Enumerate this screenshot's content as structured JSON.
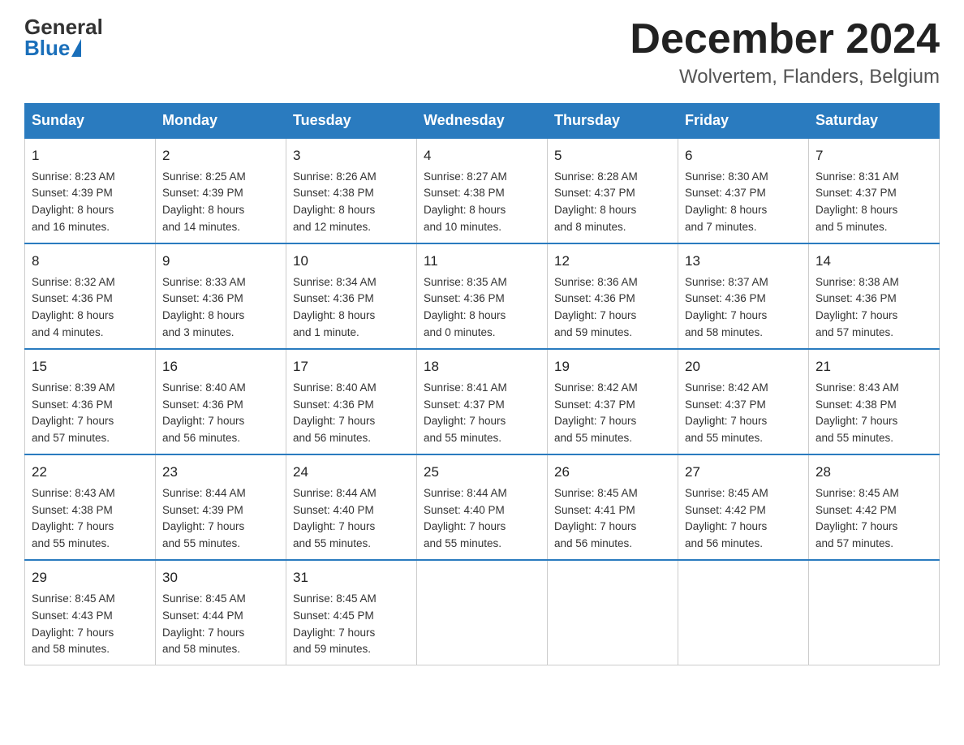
{
  "logo": {
    "general": "General",
    "blue": "Blue"
  },
  "title": {
    "month": "December 2024",
    "location": "Wolvertem, Flanders, Belgium"
  },
  "headers": [
    "Sunday",
    "Monday",
    "Tuesday",
    "Wednesday",
    "Thursday",
    "Friday",
    "Saturday"
  ],
  "weeks": [
    [
      {
        "day": "1",
        "info": "Sunrise: 8:23 AM\nSunset: 4:39 PM\nDaylight: 8 hours\nand 16 minutes."
      },
      {
        "day": "2",
        "info": "Sunrise: 8:25 AM\nSunset: 4:39 PM\nDaylight: 8 hours\nand 14 minutes."
      },
      {
        "day": "3",
        "info": "Sunrise: 8:26 AM\nSunset: 4:38 PM\nDaylight: 8 hours\nand 12 minutes."
      },
      {
        "day": "4",
        "info": "Sunrise: 8:27 AM\nSunset: 4:38 PM\nDaylight: 8 hours\nand 10 minutes."
      },
      {
        "day": "5",
        "info": "Sunrise: 8:28 AM\nSunset: 4:37 PM\nDaylight: 8 hours\nand 8 minutes."
      },
      {
        "day": "6",
        "info": "Sunrise: 8:30 AM\nSunset: 4:37 PM\nDaylight: 8 hours\nand 7 minutes."
      },
      {
        "day": "7",
        "info": "Sunrise: 8:31 AM\nSunset: 4:37 PM\nDaylight: 8 hours\nand 5 minutes."
      }
    ],
    [
      {
        "day": "8",
        "info": "Sunrise: 8:32 AM\nSunset: 4:36 PM\nDaylight: 8 hours\nand 4 minutes."
      },
      {
        "day": "9",
        "info": "Sunrise: 8:33 AM\nSunset: 4:36 PM\nDaylight: 8 hours\nand 3 minutes."
      },
      {
        "day": "10",
        "info": "Sunrise: 8:34 AM\nSunset: 4:36 PM\nDaylight: 8 hours\nand 1 minute."
      },
      {
        "day": "11",
        "info": "Sunrise: 8:35 AM\nSunset: 4:36 PM\nDaylight: 8 hours\nand 0 minutes."
      },
      {
        "day": "12",
        "info": "Sunrise: 8:36 AM\nSunset: 4:36 PM\nDaylight: 7 hours\nand 59 minutes."
      },
      {
        "day": "13",
        "info": "Sunrise: 8:37 AM\nSunset: 4:36 PM\nDaylight: 7 hours\nand 58 minutes."
      },
      {
        "day": "14",
        "info": "Sunrise: 8:38 AM\nSunset: 4:36 PM\nDaylight: 7 hours\nand 57 minutes."
      }
    ],
    [
      {
        "day": "15",
        "info": "Sunrise: 8:39 AM\nSunset: 4:36 PM\nDaylight: 7 hours\nand 57 minutes."
      },
      {
        "day": "16",
        "info": "Sunrise: 8:40 AM\nSunset: 4:36 PM\nDaylight: 7 hours\nand 56 minutes."
      },
      {
        "day": "17",
        "info": "Sunrise: 8:40 AM\nSunset: 4:36 PM\nDaylight: 7 hours\nand 56 minutes."
      },
      {
        "day": "18",
        "info": "Sunrise: 8:41 AM\nSunset: 4:37 PM\nDaylight: 7 hours\nand 55 minutes."
      },
      {
        "day": "19",
        "info": "Sunrise: 8:42 AM\nSunset: 4:37 PM\nDaylight: 7 hours\nand 55 minutes."
      },
      {
        "day": "20",
        "info": "Sunrise: 8:42 AM\nSunset: 4:37 PM\nDaylight: 7 hours\nand 55 minutes."
      },
      {
        "day": "21",
        "info": "Sunrise: 8:43 AM\nSunset: 4:38 PM\nDaylight: 7 hours\nand 55 minutes."
      }
    ],
    [
      {
        "day": "22",
        "info": "Sunrise: 8:43 AM\nSunset: 4:38 PM\nDaylight: 7 hours\nand 55 minutes."
      },
      {
        "day": "23",
        "info": "Sunrise: 8:44 AM\nSunset: 4:39 PM\nDaylight: 7 hours\nand 55 minutes."
      },
      {
        "day": "24",
        "info": "Sunrise: 8:44 AM\nSunset: 4:40 PM\nDaylight: 7 hours\nand 55 minutes."
      },
      {
        "day": "25",
        "info": "Sunrise: 8:44 AM\nSunset: 4:40 PM\nDaylight: 7 hours\nand 55 minutes."
      },
      {
        "day": "26",
        "info": "Sunrise: 8:45 AM\nSunset: 4:41 PM\nDaylight: 7 hours\nand 56 minutes."
      },
      {
        "day": "27",
        "info": "Sunrise: 8:45 AM\nSunset: 4:42 PM\nDaylight: 7 hours\nand 56 minutes."
      },
      {
        "day": "28",
        "info": "Sunrise: 8:45 AM\nSunset: 4:42 PM\nDaylight: 7 hours\nand 57 minutes."
      }
    ],
    [
      {
        "day": "29",
        "info": "Sunrise: 8:45 AM\nSunset: 4:43 PM\nDaylight: 7 hours\nand 58 minutes."
      },
      {
        "day": "30",
        "info": "Sunrise: 8:45 AM\nSunset: 4:44 PM\nDaylight: 7 hours\nand 58 minutes."
      },
      {
        "day": "31",
        "info": "Sunrise: 8:45 AM\nSunset: 4:45 PM\nDaylight: 7 hours\nand 59 minutes."
      },
      {
        "day": "",
        "info": ""
      },
      {
        "day": "",
        "info": ""
      },
      {
        "day": "",
        "info": ""
      },
      {
        "day": "",
        "info": ""
      }
    ]
  ]
}
